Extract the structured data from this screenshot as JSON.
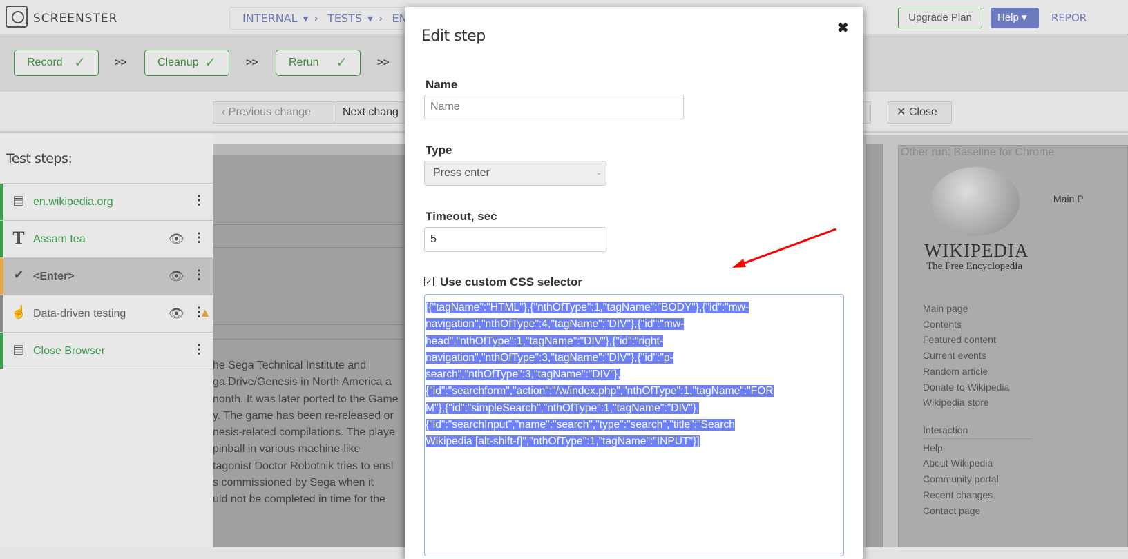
{
  "app": {
    "brand": "SCREENSTER",
    "breadcrumb": [
      "INTERNAL",
      "TESTS",
      "EN.W"
    ],
    "upgrade_label": "Upgrade Plan",
    "help_label": "Help",
    "reports_label": "REPOR"
  },
  "stages": [
    {
      "label": "Record"
    },
    {
      "label": "Cleanup"
    },
    {
      "label": "Rerun"
    }
  ],
  "stage_separator": ">>",
  "nav": {
    "previous_label": "Previous change",
    "next_label": "Next chang",
    "close_label": "Close"
  },
  "sidebar": {
    "title": "Test steps:",
    "steps": [
      {
        "label": "en.wikipedia.org",
        "icon": "browser-window-icon",
        "status_color": "#3c9a4c",
        "text_color": "#3c9a4c",
        "eye": false,
        "warning": false
      },
      {
        "label": "Assam tea",
        "icon": "text-t-icon",
        "status_color": "#3c9a4c",
        "text_color": "#3c9a4c",
        "eye": true,
        "warning": false
      },
      {
        "label": "<Enter>",
        "icon": "checkmark-icon",
        "status_color": "#e5a84a",
        "text_color": "#555",
        "eye": true,
        "warning": false,
        "selected": true
      },
      {
        "label": "Data-driven testing",
        "icon": "hand-pointer-icon",
        "status_color": "#888",
        "text_color": "#666",
        "eye": true,
        "warning": true
      },
      {
        "label": "Close Browser",
        "icon": "browser-window-icon",
        "status_color": "#3c9a4c",
        "text_color": "#3c9a4c",
        "eye": false,
        "warning": false
      }
    ]
  },
  "background_text": [
    "he Sega Technical Institute and",
    "ga Drive/Genesis in North America a",
    "nonth. It was later ported to the Game",
    "y. The game has been re-released or",
    "nesis-related compilations. The playe",
    " pinball in various machine-like",
    "tagonist Doctor Robotnik tries to ensl",
    "s commissioned by Sega when it",
    "uld not be completed in time for the"
  ],
  "other_run": {
    "header": "Other run: Baseline for Chrome",
    "wiki_name": "WIKIPEDIA",
    "wiki_sub": "The Free Encyclopedia",
    "main_tab": "Main P",
    "nav": [
      "Main page",
      "Contents",
      "Featured content",
      "Current events",
      "Random article",
      "Donate to Wikipedia",
      "Wikipedia store"
    ],
    "interaction_heading": "Interaction",
    "interaction": [
      "Help",
      "About Wikipedia",
      "Community portal",
      "Recent changes",
      "Contact page"
    ]
  },
  "modal": {
    "title": "Edit step",
    "close": "✖",
    "name_label": "Name",
    "name_value": "",
    "name_placeholder": "Name",
    "type_label": "Type",
    "type_value": "Press enter",
    "timeout_label": "Timeout, sec",
    "timeout_value": "5",
    "custom_css_label": "Use custom CSS selector",
    "custom_css_checked": true,
    "selector_lines": [
      "[{\"tagName\":\"HTML\"},{\"nthOfType\":1,\"tagName\":\"BODY\"},{\"id\":\"mw-",
      "navigation\",\"nthOfType\":4,\"tagName\":\"DIV\"},{\"id\":\"mw-",
      "head\",\"nthOfType\":1,\"tagName\":\"DIV\"},{\"id\":\"right-",
      "navigation\",\"nthOfType\":3,\"tagName\":\"DIV\"},{\"id\":\"p-",
      "search\",\"nthOfType\":3,\"tagName\":\"DIV\"},",
      "{\"id\":\"searchform\",\"action\":\"/w/index.php\",\"nthOfType\":1,\"tagName\":\"FOR",
      "M\"},{\"id\":\"simpleSearch\",\"nthOfType\":1,\"tagName\":\"DIV\"},",
      "{\"id\":\"searchInput\",\"name\":\"search\",\"type\":\"search\",\"title\":\"Search",
      "Wikipedia [alt-shift-f]\",\"nthOfType\":1,\"tagName\":\"INPUT\"}]"
    ]
  },
  "colors": {
    "accent_green": "#3c9a4c",
    "help_blue": "#6c7bc0",
    "selection": "#6d80f4",
    "annotation_arrow": "#ff0000"
  }
}
